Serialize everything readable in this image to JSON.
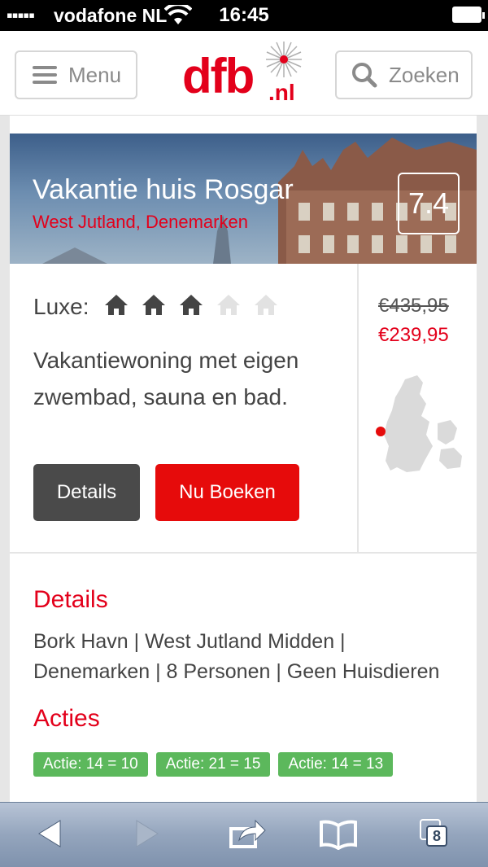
{
  "status_bar": {
    "signal": "▪▪▪▪▪",
    "carrier": "vodafone NL",
    "time": "16:45"
  },
  "header": {
    "menu_label": "Menu",
    "logo_main": "dfb",
    "logo_suffix": ".nl",
    "search_label": "Zoeken"
  },
  "property": {
    "title": "Vakantie huis Rosgar",
    "region": "West Jutland, Denemarken",
    "rating": "7.4",
    "luxe_label": "Luxe:",
    "luxe_score": 3,
    "luxe_max": 5,
    "description": "Vakantiewoning met eigen zwembad, sauna en bad.",
    "details_button": "Details",
    "book_button": "Nu Boeken",
    "old_price": "€435,95",
    "new_price": "€239,95"
  },
  "details": {
    "title": "Details",
    "text": "Bork Havn | West Jutland Midden | Denemarken | 8 Personen | Geen Huisdieren"
  },
  "acties": {
    "title": "Acties",
    "items": [
      "Actie: 14 = 10",
      "Actie: 21 = 15",
      "Actie: 14 = 13"
    ]
  },
  "toolbar": {
    "tabs_count": "8"
  },
  "colors": {
    "brand_red": "#e3001b",
    "badge_green": "#5cb85c",
    "details_button": "#4a4a4a"
  }
}
